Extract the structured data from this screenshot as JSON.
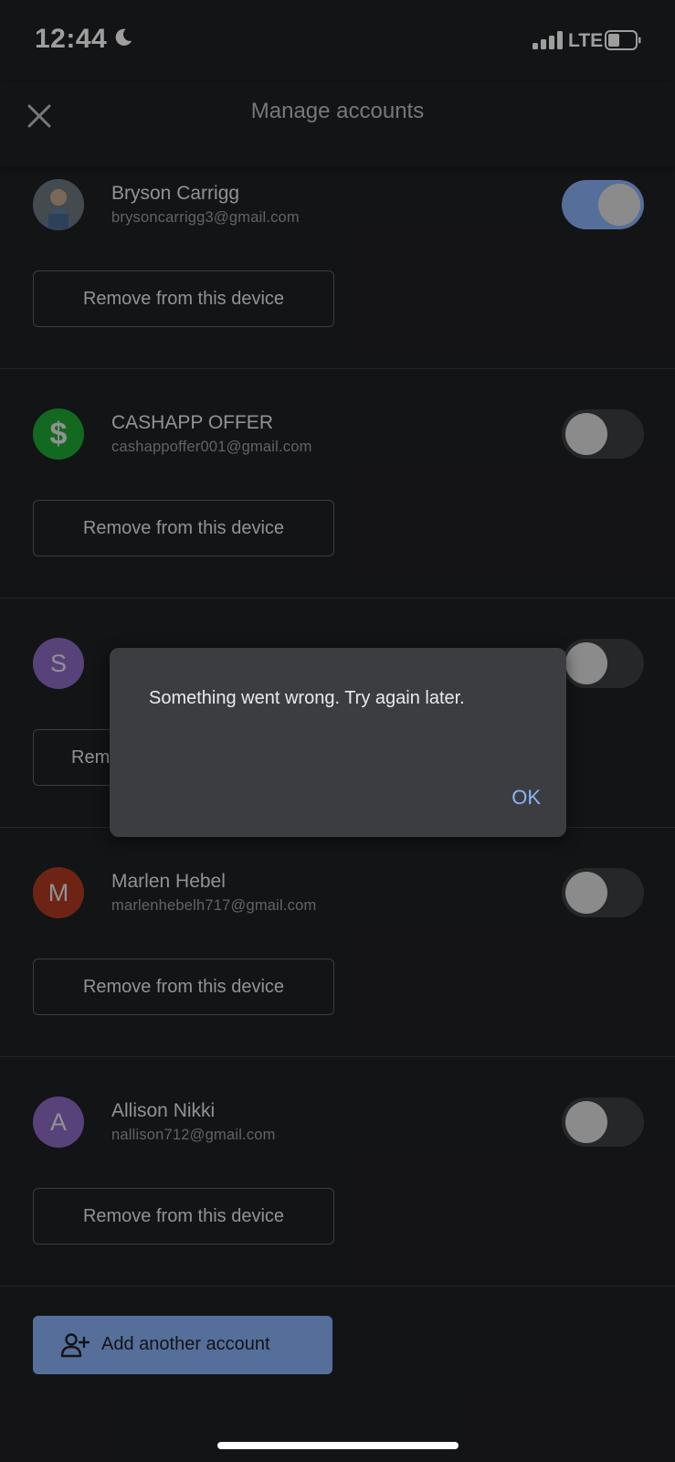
{
  "status_bar": {
    "time": "12:44",
    "network": "LTE"
  },
  "header": {
    "title": "Manage accounts"
  },
  "accounts": [
    {
      "name": "Bryson Carrigg",
      "email": "brysoncarrigg3@gmail.com",
      "avatar_letter": "",
      "avatar_color": "#5b6b7a",
      "toggle_on": true,
      "remove_label": "Remove from this device"
    },
    {
      "name": "CASHAPP OFFER",
      "email": "cashappoffer001@gmail.com",
      "avatar_letter": "$",
      "avatar_color": "#1faa34",
      "toggle_on": false,
      "remove_label": "Remove from this device"
    },
    {
      "name": "",
      "email": "",
      "avatar_letter": "S",
      "avatar_color": "#8e6bc6",
      "toggle_on": false,
      "remove_label": "Rem"
    },
    {
      "name": "Marlen Hebel",
      "email": "marlenhebelh717@gmail.com",
      "avatar_letter": "M",
      "avatar_color": "#b23a22",
      "toggle_on": false,
      "remove_label": "Remove from this device"
    },
    {
      "name": "Allison Nikki",
      "email": "nallison712@gmail.com",
      "avatar_letter": "A",
      "avatar_color": "#8e6bc6",
      "toggle_on": false,
      "remove_label": "Remove from this device"
    }
  ],
  "add_account": {
    "label": "Add another account",
    "icon": "person-add-icon"
  },
  "dialog": {
    "message": "Something went wrong. Try again later.",
    "ok_label": "OK"
  },
  "colors": {
    "background": "#202124",
    "accent": "#8ab4f8",
    "dialog": "#3c3d40"
  }
}
